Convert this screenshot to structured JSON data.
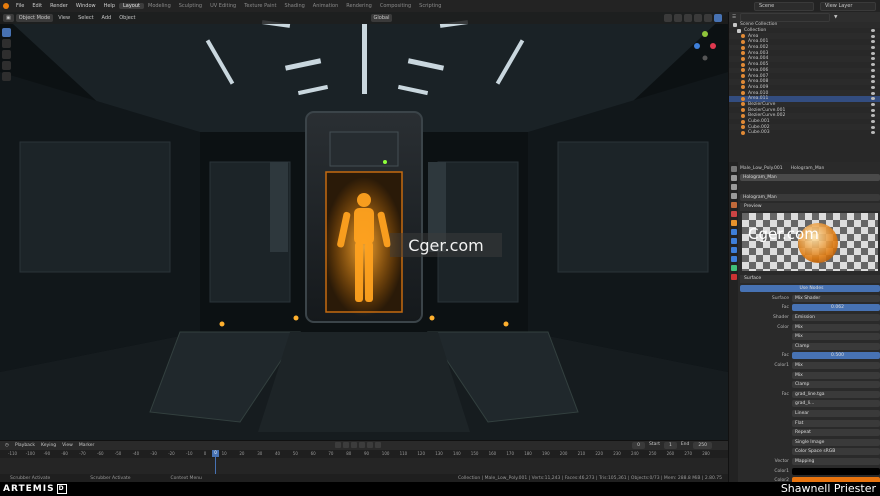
{
  "topbar": {
    "menus": [
      "File",
      "Edit",
      "Render",
      "Window",
      "Help"
    ],
    "workspaces": [
      "Layout",
      "Modeling",
      "Sculpting",
      "UV Editing",
      "Texture Paint",
      "Shading",
      "Animation",
      "Rendering",
      "Compositing",
      "Scripting"
    ],
    "active_workspace": "Layout",
    "scene": "Scene",
    "view_layer": "View Layer"
  },
  "viewport": {
    "mode": "Object Mode",
    "menus": [
      "View",
      "Select",
      "Add",
      "Object"
    ],
    "orientation": "Global"
  },
  "watermark": "Cger.com",
  "timeline": {
    "menus": [
      "Playback",
      "Keying",
      "View",
      "Marker"
    ],
    "current_frame": "0",
    "start_label": "Start",
    "start": "1",
    "end_label": "End",
    "end": "250",
    "ticks": [
      "-110",
      "-100",
      "-90",
      "-80",
      "-70",
      "-60",
      "-50",
      "-40",
      "-30",
      "-20",
      "-10",
      "0",
      "10",
      "20",
      "30",
      "40",
      "50",
      "60",
      "70",
      "80",
      "90",
      "100",
      "110",
      "120",
      "130",
      "140",
      "150",
      "160",
      "170",
      "180",
      "190",
      "200",
      "210",
      "220",
      "230",
      "240",
      "250",
      "260",
      "270",
      "280"
    ]
  },
  "statusbar": {
    "left": "Scrubber Activate",
    "mid": "Scrubber Activate",
    "right_hint": "Context Menu",
    "stats": "Collection | Male_Low_Poly.001 | Verts:11,243 | Faces:46,273 | Tris:105,361 | Objects:0/73 | Mem: 288.8 MiB | 2.80.75"
  },
  "branding": {
    "logo": "ARTEMIS",
    "logo_box": "D",
    "author": "Shawnell Priester"
  },
  "outliner": {
    "title": "Scene Collection",
    "items": [
      {
        "name": "Collection",
        "kind": "collection"
      },
      {
        "name": "Area",
        "kind": "light"
      },
      {
        "name": "Area.001",
        "kind": "light"
      },
      {
        "name": "Area.002",
        "kind": "light"
      },
      {
        "name": "Area.003",
        "kind": "light"
      },
      {
        "name": "Area.004",
        "kind": "light"
      },
      {
        "name": "Area.005",
        "kind": "light"
      },
      {
        "name": "Area.006",
        "kind": "light"
      },
      {
        "name": "Area.007",
        "kind": "light"
      },
      {
        "name": "Area.008",
        "kind": "light"
      },
      {
        "name": "Area.009",
        "kind": "light"
      },
      {
        "name": "Area.010",
        "kind": "light"
      },
      {
        "name": "Area.011",
        "kind": "light",
        "selected": true
      },
      {
        "name": "BezierCurve",
        "kind": "curve"
      },
      {
        "name": "BezierCurve.001",
        "kind": "curve"
      },
      {
        "name": "BezierCurve.002",
        "kind": "curve"
      },
      {
        "name": "Cube.001",
        "kind": "mesh"
      },
      {
        "name": "Cube.002",
        "kind": "mesh"
      },
      {
        "name": "Cube.003",
        "kind": "mesh"
      }
    ]
  },
  "properties": {
    "object": "Male_Low_Poly.001",
    "material_tab": "Hologram_Man",
    "slot": "Hologram_Man",
    "datablock": "Hologram_Man",
    "preview_label": "Preview",
    "surface_label": "Surface",
    "use_nodes": "Use Nodes",
    "rows": [
      {
        "label": "Surface",
        "value": "Mix Shader",
        "style": "dark"
      },
      {
        "label": "Fac",
        "value": "0.062",
        "style": "blue"
      },
      {
        "label": "Shader",
        "value": "Emission",
        "style": "dark"
      },
      {
        "label": "Color",
        "value": "Mix",
        "style": "dark"
      },
      {
        "label": "",
        "value": "Mix",
        "style": "dark"
      },
      {
        "label": "",
        "value": "Clamp",
        "style": "dark"
      },
      {
        "label": "Fac",
        "value": "0.500",
        "style": "blue"
      },
      {
        "label": "Color1",
        "value": "Mix",
        "style": "dark"
      },
      {
        "label": "",
        "value": "Mix",
        "style": "dark"
      },
      {
        "label": "",
        "value": "Clamp",
        "style": "dark"
      },
      {
        "label": "Fac",
        "value": "grad_line.tga",
        "style": "dark"
      },
      {
        "label": "",
        "value": "grad_li...",
        "style": "dark"
      },
      {
        "label": "",
        "value": "Linear",
        "style": "dark"
      },
      {
        "label": "",
        "value": "Flat",
        "style": "dark"
      },
      {
        "label": "",
        "value": "Repeat",
        "style": "dark"
      },
      {
        "label": "",
        "value": "Single Image",
        "style": "dark"
      },
      {
        "label": "",
        "value": "Color Space    sRGB",
        "style": "dark"
      },
      {
        "label": "Vector",
        "value": "Mapping",
        "style": "dark"
      },
      {
        "label": "Color1",
        "value": "",
        "style": "black"
      },
      {
        "label": "Color2",
        "value": "",
        "style": "orange"
      }
    ]
  },
  "colors": {
    "accent": "#4772b3",
    "hologram": "#ff9a1a",
    "orange_swatch": "#e8740f"
  }
}
